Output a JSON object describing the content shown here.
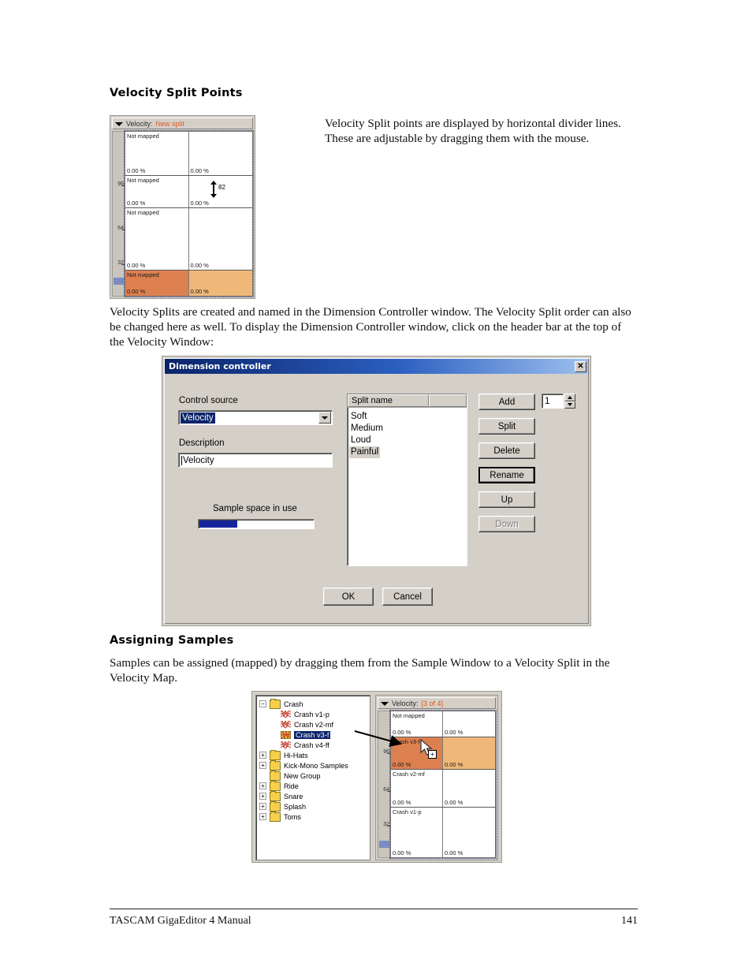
{
  "page": {
    "footer_title": "TASCAM GigaEditor 4 Manual",
    "page_number": "141"
  },
  "section_velocity_split_points": {
    "heading": "Velocity Split Points",
    "paragraph_right": "Velocity Split points are displayed by horizontal divider lines. These are adjustable by dragging them with the mouse.",
    "paragraph_below": "Velocity Splits are created and named in the Dimension Controller window.  The Velocity Split order can also be changed here as well.  To display the Dimension Controller window, click on the header bar at the top of the Velocity Window:"
  },
  "velocity_window_top": {
    "title_label": "Velocity:",
    "title_accent": "New split",
    "axis_ticks": [
      "96",
      "64",
      "32"
    ],
    "drag_value": "82",
    "rows": [
      {
        "name": "Not mapped",
        "left_percent": "0.00 %",
        "right_percent": "0.00 %",
        "mapped": false
      },
      {
        "name": "Not mapped",
        "left_percent": "0.00 %",
        "right_percent": "0.00 %",
        "mapped": false
      },
      {
        "name": "Not mapped",
        "left_percent": "0.00 %",
        "right_percent": "0.00 %",
        "mapped": false
      },
      {
        "name": "Not mapped",
        "left_percent": "0.00 %",
        "right_percent": "0.00 %",
        "mapped": true
      }
    ],
    "colors": {
      "cell_left_orange": "#dd8050",
      "cell_right_orange": "#f0b878",
      "accent_text": "#e2591f"
    }
  },
  "dimension_controller": {
    "title": "Dimension controller",
    "close_label": "✕",
    "control_source_label": "Control source",
    "control_source_value": "Velocity",
    "description_label": "Description",
    "description_value": "Velocity",
    "sample_space_label": "Sample space in use",
    "sample_space_percent": 33,
    "list_header": "Split name",
    "splits": [
      "Soft",
      "Medium",
      "Loud",
      "Painful"
    ],
    "selected_split": "Painful",
    "buttons": {
      "add": "Add",
      "split": "Split",
      "delete": "Delete",
      "rename": "Rename",
      "up": "Up",
      "down": "Down",
      "ok": "OK",
      "cancel": "Cancel"
    },
    "spinner_value": "1",
    "disabled_buttons": [
      "Down"
    ],
    "focused_button": "Rename"
  },
  "section_assigning_samples": {
    "heading": "Assigning Samples",
    "paragraph": "Samples can be assigned (mapped) by dragging them from the Sample Window to a Velocity Split in the Velocity Map."
  },
  "sample_window_tree": {
    "nodes": [
      {
        "label": "Crash",
        "type": "folder",
        "expander": "−",
        "level": 0
      },
      {
        "label": "Crash v1-p",
        "type": "wave",
        "level": 1
      },
      {
        "label": "Crash v2-mf",
        "type": "wave",
        "level": 1
      },
      {
        "label": "Crash v3-f",
        "type": "wave",
        "level": 1,
        "selected": true
      },
      {
        "label": "Crash v4-ff",
        "type": "wave",
        "level": 1
      },
      {
        "label": "Hi-Hats",
        "type": "folder",
        "expander": "+",
        "level": 0
      },
      {
        "label": "Kick-Mono Samples",
        "type": "folder",
        "expander": "+",
        "level": 0
      },
      {
        "label": "New Group",
        "type": "folder",
        "expander": "",
        "level": 0
      },
      {
        "label": "Ride",
        "type": "folder",
        "expander": "+",
        "level": 0
      },
      {
        "label": "Snare",
        "type": "folder",
        "expander": "+",
        "level": 0
      },
      {
        "label": "Splash",
        "type": "folder",
        "expander": "+",
        "level": 0
      },
      {
        "label": "Toms",
        "type": "folder",
        "expander": "+",
        "level": 0
      }
    ]
  },
  "velocity_window_bottom": {
    "title_label": "Velocity:",
    "title_accent": "[3 of 4]",
    "axis_ticks": [
      "96",
      "64",
      "32"
    ],
    "drop_badge": "+",
    "rows": [
      {
        "name": "Not mapped",
        "left_percent": "0.00 %",
        "right_percent": "0.00 %",
        "mapped": false
      },
      {
        "name": "Crash v3-f",
        "left_percent": "0.00 %",
        "right_percent": "0.00 %",
        "mapped": true
      },
      {
        "name": "Crash v2-mf",
        "left_percent": "0.00 %",
        "right_percent": "0.00 %",
        "mapped": false
      },
      {
        "name": "Crash v1-p",
        "left_percent": "0.00 %",
        "right_percent": "0.00 %",
        "mapped": false
      }
    ]
  }
}
